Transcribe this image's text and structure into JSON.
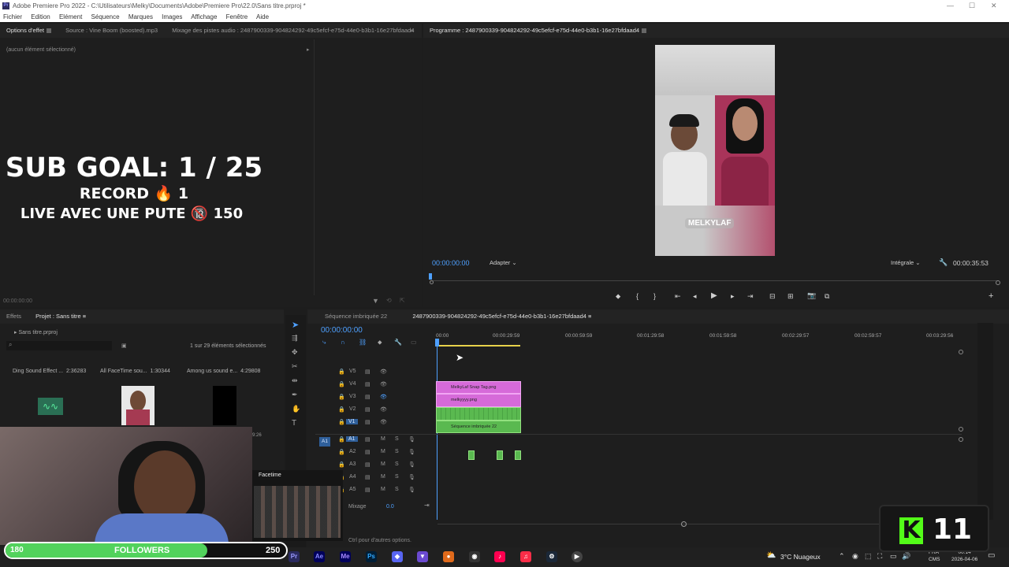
{
  "window": {
    "title": "Adobe Premiere Pro 2022 - C:\\Utilisateurs\\Melky\\Documents\\Adobe\\Premiere Pro\\22.0\\Sans titre.prproj *"
  },
  "menu": [
    "Fichier",
    "Edition",
    "Elément",
    "Séquence",
    "Marques",
    "Images",
    "Affichage",
    "Fenêtre",
    "Aide"
  ],
  "top_left_panel": {
    "tabs": [
      "Options d'effet",
      "Source : Vine Boom (boosted).mp3",
      "Mixage des pistes audio : 2487900339-904824292-49c5efcf-e75d-44e0-b3b1-16e27bfdaad4"
    ],
    "no_selection": "(aucun élément sélectionné)",
    "timecode": "00:00:00:00"
  },
  "overlay": {
    "goal": "SUB GOAL: 1 / 25",
    "record": "RECORD 🔥 1",
    "live": "LIVE AVEC UNE PUTE 🔞 150"
  },
  "program": {
    "tab": "Programme : 2487900339-904824292-49c5efcf-e75d-44e0-b3b1-16e27bfdaad4",
    "timecode": "00:00:00:00",
    "fit": "Adapter",
    "quality": "Intégrale",
    "duration": "00:00:35:53",
    "video_tag": "MELKYLAF"
  },
  "project": {
    "tabs": [
      "Effets",
      "Projet : Sans titre"
    ],
    "filename": "Sans titre.prproj",
    "selection_count": "1 sur 29 éléments sélectionnés",
    "items": [
      {
        "name": "Ding Sound Effect ...",
        "duration": "2:36283"
      },
      {
        "name": "All FaceTime sou...",
        "duration": "1:30344"
      },
      {
        "name": "Among us sound e...",
        "duration": "4:29808"
      }
    ],
    "partial_duration": "9:26"
  },
  "timeline": {
    "tabs": [
      "Séquence imbriquée 22",
      "2487900339-904824292-49c5efcf-e75d-44e0-b3b1-16e27bfdaad4"
    ],
    "timecode": "00:00:00:00",
    "ruler": [
      "00:00",
      "00:00:29:59",
      "00:00:59:59",
      "00:01:29:58",
      "00:01:59:58",
      "00:02:29:57",
      "00:02:59:57",
      "00:03:29:56"
    ],
    "video_tracks": [
      "V5",
      "V4",
      "V3",
      "V2",
      "V1"
    ],
    "audio_tracks": [
      "A1",
      "A2",
      "A3",
      "A4",
      "A5"
    ],
    "source_patch": "A1",
    "mix_label": "Mixage",
    "mix_value": "0.0",
    "clips": {
      "v4": "MelkyLaf Snap Tag.png",
      "v3": "melkyyyy.png",
      "v1": "Séquence imbriquée 22"
    },
    "status": "Ctrl pour d'autres options."
  },
  "facetime": {
    "label": "Facetime"
  },
  "followers": {
    "current": "180",
    "label": "FOLLOWERS",
    "goal": "250",
    "progress": 0.72
  },
  "kick": {
    "count": "11"
  },
  "taskbar": {
    "weather": "3°C  Nuageux",
    "lang1": "FRA",
    "lang2": "CMS",
    "time": "00:14",
    "date": "2026-04-06"
  },
  "colors": {
    "accent": "#4ea0ff",
    "clip_pink": "#d66ad9",
    "clip_green": "#5ab950",
    "followers_bar": "#52d25c",
    "kick": "#53fc18"
  }
}
